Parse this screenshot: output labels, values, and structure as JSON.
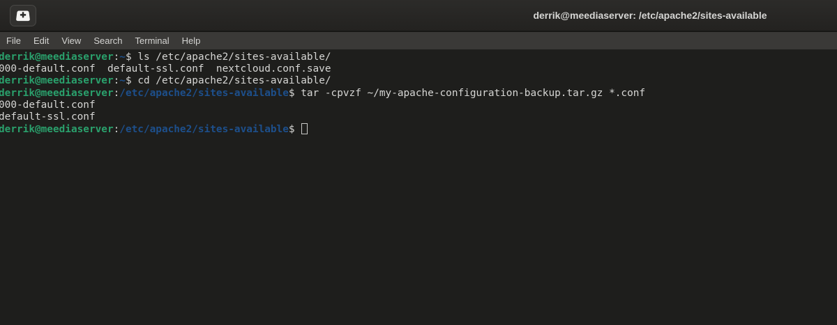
{
  "window": {
    "title": "derrik@meediaserver: /etc/apache2/sites-available"
  },
  "menu": {
    "items": [
      "File",
      "Edit",
      "View",
      "Search",
      "Terminal",
      "Help"
    ]
  },
  "colors": {
    "prompt_green": "#2aa06c",
    "prompt_blue": "#1d4f8b",
    "terminal_fg": "#d6d6d4",
    "terminal_bg": "#1e1e1c",
    "menubar_bg": "#3a3937",
    "titlebar_bg": "#262523"
  },
  "terminal": {
    "lines": [
      {
        "type": "prompt",
        "user": "derrik@meediaserver",
        "colon": ":",
        "path": "~",
        "prompt_symbol": "$",
        "command": "ls /etc/apache2/sites-available/"
      },
      {
        "type": "output",
        "text": "000-default.conf  default-ssl.conf  nextcloud.conf.save"
      },
      {
        "type": "prompt",
        "user": "derrik@meediaserver",
        "colon": ":",
        "path": "~",
        "prompt_symbol": "$",
        "command": "cd /etc/apache2/sites-available/"
      },
      {
        "type": "prompt",
        "user": "derrik@meediaserver",
        "colon": ":",
        "path": "/etc/apache2/sites-available",
        "prompt_symbol": "$",
        "command": "tar -cpvzf ~/my-apache-configuration-backup.tar.gz *.conf"
      },
      {
        "type": "output",
        "text": "000-default.conf"
      },
      {
        "type": "output",
        "text": "default-ssl.conf"
      },
      {
        "type": "prompt",
        "user": "derrik@meediaserver",
        "colon": ":",
        "path": "/etc/apache2/sites-available",
        "prompt_symbol": "$",
        "command": "",
        "cursor": true
      }
    ]
  }
}
